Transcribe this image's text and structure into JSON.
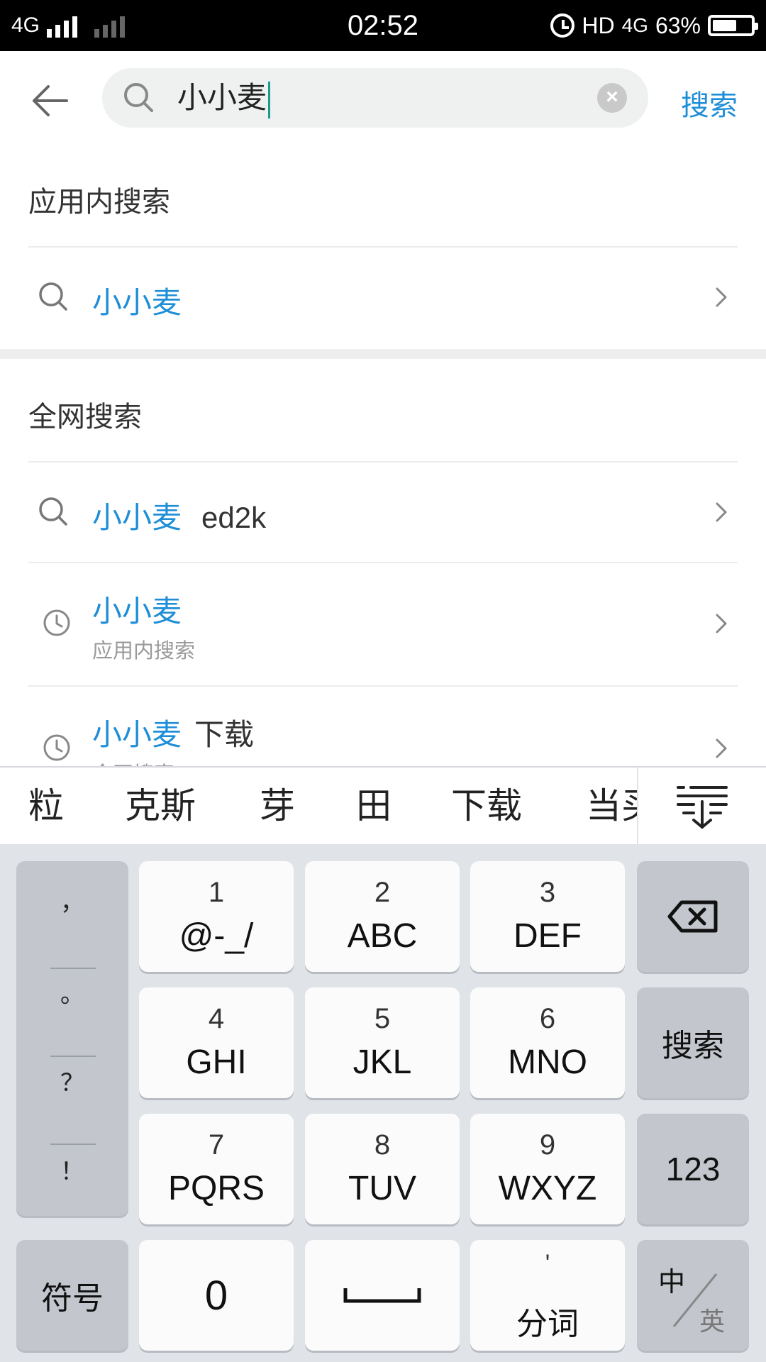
{
  "status_bar": {
    "network": "4G",
    "time": "02:52",
    "hd_label": "HD",
    "network2": "4G",
    "battery": "63%",
    "battery_level": 0.63
  },
  "search": {
    "query": "小小麦",
    "submit_label": "搜索"
  },
  "in_app": {
    "title": "应用内搜索",
    "item": "小小麦"
  },
  "web": {
    "title": "全网搜索",
    "items": [
      {
        "main": "小小麦",
        "extra": "ed2k",
        "sub": "",
        "icon": "search-icon"
      },
      {
        "main": "小小麦",
        "extra": "",
        "sub": "应用内搜索",
        "icon": "history-clock-icon"
      },
      {
        "main": "小小麦",
        "extra": "下载",
        "sub": "全网搜索",
        "icon": "history-clock-icon"
      }
    ]
  },
  "candidates": [
    "粒",
    "克斯",
    "芽",
    "田",
    "下载",
    "当买"
  ],
  "keyboard": {
    "punctuation": [
      "，",
      "。",
      "？",
      "！"
    ],
    "keys": [
      {
        "num": "1",
        "letters": "@-_/"
      },
      {
        "num": "2",
        "letters": "ABC"
      },
      {
        "num": "3",
        "letters": "DEF"
      },
      {
        "num": "4",
        "letters": "GHI"
      },
      {
        "num": "5",
        "letters": "JKL"
      },
      {
        "num": "6",
        "letters": "MNO"
      },
      {
        "num": "7",
        "letters": "PQRS"
      },
      {
        "num": "8",
        "letters": "TUV"
      },
      {
        "num": "9",
        "letters": "WXYZ"
      }
    ],
    "search_key": "搜索",
    "num_switch": "123",
    "symbol_key": "符号",
    "zero_key": "0",
    "separator_mark": "'",
    "separator_key": "分词",
    "lang_zh": "中",
    "lang_en": "英"
  }
}
